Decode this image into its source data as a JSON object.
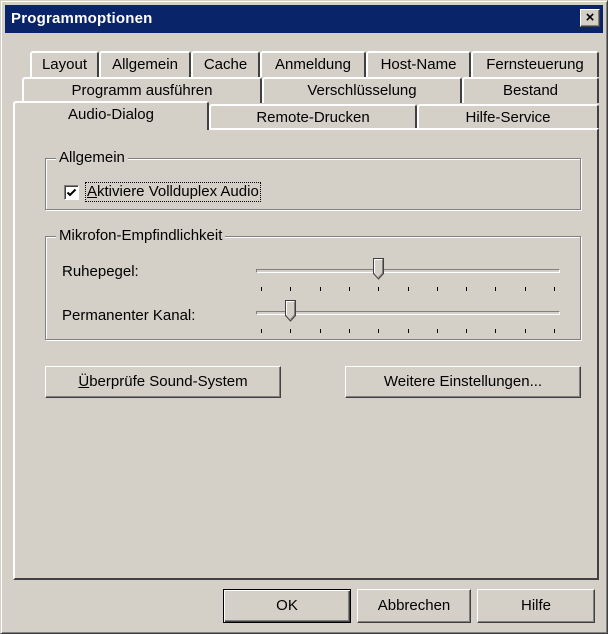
{
  "window": {
    "title": "Programmoptionen",
    "close_icon": "close-icon"
  },
  "tabs": {
    "row1": [
      "Layout",
      "Allgemein",
      "Cache",
      "Anmeldung",
      "Host-Name",
      "Fernsteuerung"
    ],
    "row2": [
      "Programm ausführen",
      "Verschlüsselung",
      "Bestand"
    ],
    "row3": [
      "Audio-Dialog",
      "Remote-Drucken",
      "Hilfe-Service"
    ],
    "active": "Audio-Dialog"
  },
  "general_group": {
    "title": "Allgemein",
    "checkbox_label_first": "A",
    "checkbox_label_rest": "ktiviere Vollduplex Audio",
    "checked": true
  },
  "mic_group": {
    "title": "Mikrofon-Empfindlichkeit",
    "idle_label": "Ruhepegel:",
    "idle_level": 0.4,
    "permanent_label": "Permanenter Kanal:",
    "permanent_level": 0.1,
    "tick_count": 11
  },
  "buttons": {
    "check_sound_first": "Ü",
    "check_sound_rest": "berprüfe Sound-System",
    "more_settings": "Weitere Einstellungen...",
    "ok": "OK",
    "cancel": "Abbrechen",
    "help": "Hilfe"
  },
  "colors": {
    "titlebar": "#0a246a",
    "face": "#d4d0c8"
  }
}
